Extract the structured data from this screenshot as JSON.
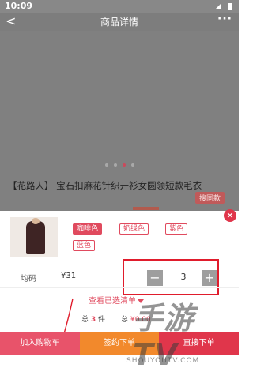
{
  "status_bar": {
    "time": "10:09"
  },
  "header": {
    "back_icon": "chevron-left-icon",
    "title": "商品详情",
    "more_label": "···"
  },
  "carousel": {
    "active_index": 2,
    "count": 4
  },
  "product": {
    "name": "【花路人】 宝石扣麻花针织开衫女圆领短款毛衣",
    "tag": "搜同款"
  },
  "sku_sheet": {
    "close_label": "×",
    "colors": [
      {
        "label": "咖啡色",
        "selected": true
      },
      {
        "label": "奶绿色",
        "selected": false
      },
      {
        "label": "紫色",
        "selected": false
      },
      {
        "label": "蓝色",
        "selected": false
      }
    ],
    "size_label": "均码",
    "price": "¥31",
    "minus_label": "−",
    "plus_label": "+",
    "quantity": "3",
    "view_selected": "查看已选清单",
    "total_prefix": "总",
    "total_count": "3",
    "total_unit": "件",
    "total_prefix2": "总",
    "total_amount": "¥0.00"
  },
  "actions": {
    "add_to_cart": "加入购物车",
    "contract_order": "签约下单",
    "buy_now": "直接下单"
  },
  "watermark": {
    "text": "手游TV",
    "url": "SHOUYOUTV.COM"
  },
  "colors": {
    "accent": "#e04a5e",
    "orange": "#f2892c",
    "highlight_border": "#e01c2c"
  }
}
